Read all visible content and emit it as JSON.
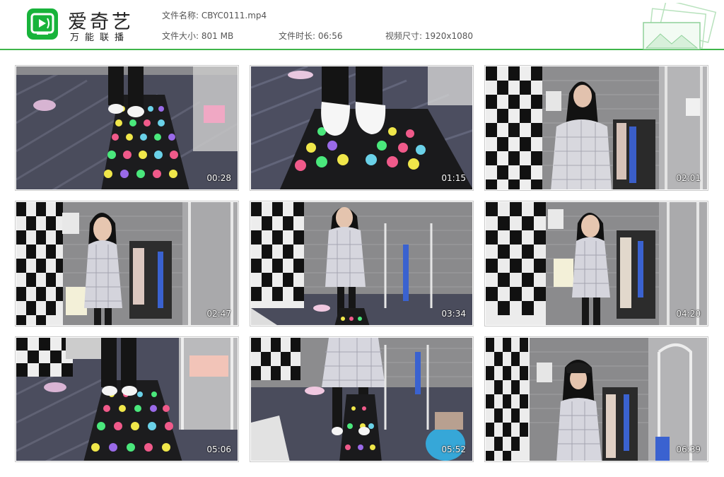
{
  "brand": {
    "title": "爱奇艺",
    "subtitle": "万能联播",
    "logo_icon": "iqiyi-tv-icon",
    "accent_color": "#18b33b",
    "rule_color": "#3fb54a"
  },
  "file_info": {
    "name_label": "文件名称:",
    "name_value": "CBYC0111.mp4",
    "size_label": "文件大小:",
    "size_value": "801 MB",
    "duration_label": "文件时长:",
    "duration_value": "06:56",
    "resolution_label": "视频尺寸:",
    "resolution_value": "1920x1080"
  },
  "decoration_icon": "stacked-photos-icon",
  "thumbnails": [
    {
      "timestamp": "00:28",
      "scene": "feet-on-mat"
    },
    {
      "timestamp": "01:15",
      "scene": "feet-closeup"
    },
    {
      "timestamp": "02:01",
      "scene": "girl-standing-wall"
    },
    {
      "timestamp": "02:47",
      "scene": "girl-smiling-room"
    },
    {
      "timestamp": "03:34",
      "scene": "girl-walking-mat"
    },
    {
      "timestamp": "04:20",
      "scene": "girl-standing-room"
    },
    {
      "timestamp": "05:06",
      "scene": "feet-on-mat-wide"
    },
    {
      "timestamp": "05:52",
      "scene": "legs-on-mat"
    },
    {
      "timestamp": "06:39",
      "scene": "girl-with-cap"
    }
  ]
}
